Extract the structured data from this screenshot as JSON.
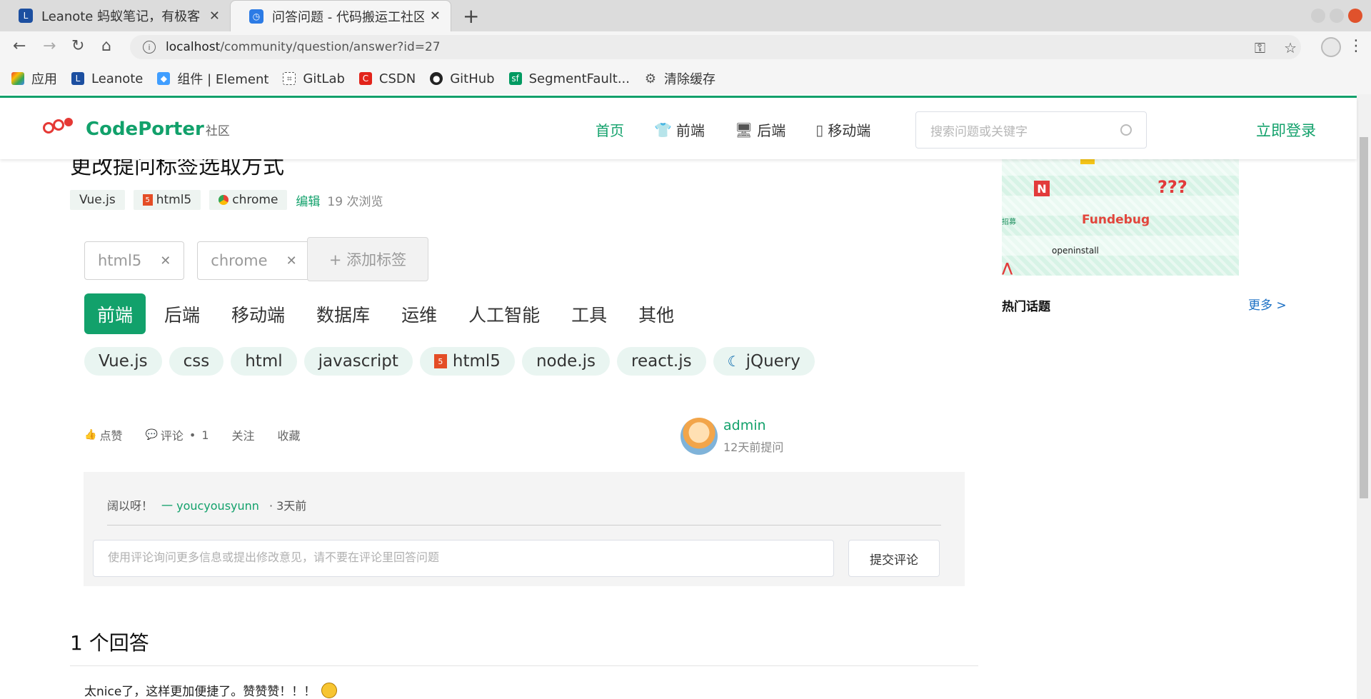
{
  "browser": {
    "tabs": [
      {
        "title": "Leanote 蚂蚁笔记，有极客",
        "active": false,
        "favicon_color": "#1c4fa0"
      },
      {
        "title": "问答问题 - 代码搬运工社区",
        "active": true,
        "favicon_color": "#2c7be5"
      }
    ],
    "url_host": "localhost",
    "url_path": "/community/question/answer?id=27",
    "bookmarks": [
      {
        "label": "应用",
        "icon": "apps-grid-icon"
      },
      {
        "label": "Leanote",
        "icon": "leanote-icon"
      },
      {
        "label": "组件 | Element",
        "icon": "element-icon"
      },
      {
        "label": "GitLab",
        "icon": "gitlab-icon"
      },
      {
        "label": "CSDN",
        "icon": "csdn-icon"
      },
      {
        "label": "GitHub",
        "icon": "github-icon"
      },
      {
        "label": "SegmentFault...",
        "icon": "segmentfault-icon"
      },
      {
        "label": "清除缓存",
        "icon": "gear-icon"
      }
    ]
  },
  "header": {
    "brand": "CodePorter",
    "brand_sub": "社区",
    "nav": [
      {
        "label": "首页",
        "icon": "",
        "active": true
      },
      {
        "label": "前端",
        "icon": "tshirt-icon",
        "active": false
      },
      {
        "label": "后端",
        "icon": "server-icon",
        "active": false
      },
      {
        "label": "移动端",
        "icon": "mobile-icon",
        "active": false
      }
    ],
    "search_placeholder": "搜索问题或关键字",
    "login": "立即登录",
    "accent": "#12a16b"
  },
  "question": {
    "title": "更改提问标签选取方式",
    "tags": [
      "Vue.js",
      "html5",
      "chrome"
    ],
    "edit": "编辑",
    "views": "19 次浏览",
    "selected_tags": [
      "html5",
      "chrome"
    ],
    "add_tag": "+ 添加标签",
    "categories": [
      "前端",
      "后端",
      "移动端",
      "数据库",
      "运维",
      "人工智能",
      "工具",
      "其他"
    ],
    "subtags": [
      "Vue.js",
      "css",
      "html",
      "javascript",
      "html5",
      "node.js",
      "react.js",
      "jQuery"
    ],
    "actions": {
      "like": "点赞",
      "comment": "评论",
      "comment_count": "1",
      "follow": "关注",
      "favorite": "收藏"
    },
    "author": {
      "name": "admin",
      "time": "12天前提问"
    }
  },
  "comment": {
    "text": "阔以呀！",
    "user": "一 youcyousyunn",
    "time": "· 3天前",
    "input_placeholder": "使用评论询问更多信息或提出修改意见，请不要在评论里回答问题",
    "submit": "提交评论"
  },
  "answers": {
    "title": "1 个回答",
    "items": [
      {
        "text": "太nice了，这样更加便捷了。赞赞赞！！！"
      }
    ]
  },
  "sidebar": {
    "ad": {
      "q": "???",
      "recruit": "招募",
      "fundebug": "Fundebug",
      "openinstall": "openinstall"
    },
    "hot_title": "热门话题",
    "more": "更多 >"
  }
}
